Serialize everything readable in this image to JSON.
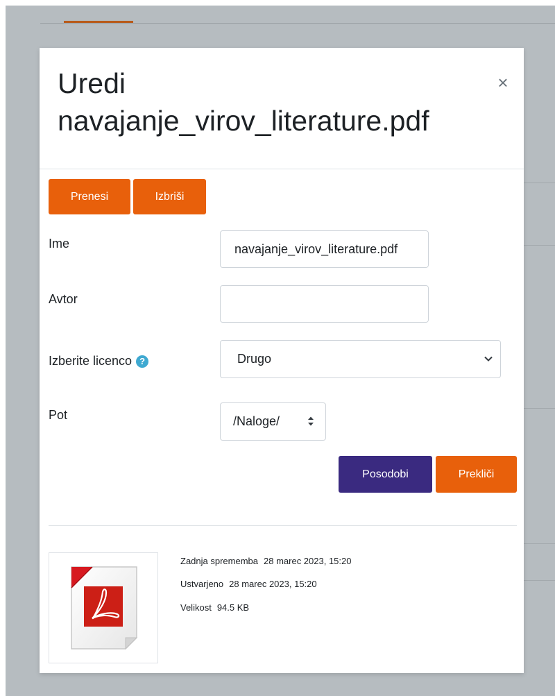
{
  "dialog": {
    "title_line1": "Uredi",
    "title_line2": "navajanje_virov_literature.pdf",
    "close_symbol": "×"
  },
  "toolbar": {
    "upload_label": "Prenesi",
    "delete_label": "Izbriši"
  },
  "form": {
    "name_label": "Ime",
    "name_value": "navajanje_virov_literature.pdf",
    "author_label": "Avtor",
    "author_value": "",
    "license_label": "Izberite licenco",
    "license_help_symbol": "?",
    "license_value": "Drugo",
    "path_label": "Pot",
    "path_value": "/Naloge/"
  },
  "actions": {
    "update_label": "Posodobi",
    "cancel_label": "Prekliči"
  },
  "file_info": {
    "modified_label": "Zadnja sprememba",
    "modified_value": "28 marec 2023, 15:20",
    "created_label": "Ustvarjeno",
    "created_value": "28 marec 2023, 15:20",
    "size_label": "Velikost",
    "size_value": "94.5 KB",
    "icon": "pdf-file-icon"
  },
  "colors": {
    "primary_orange": "#e8600b",
    "primary_purple": "#3a2a80",
    "help_blue": "#3fa9d1",
    "backdrop": "#b6bcc0"
  }
}
